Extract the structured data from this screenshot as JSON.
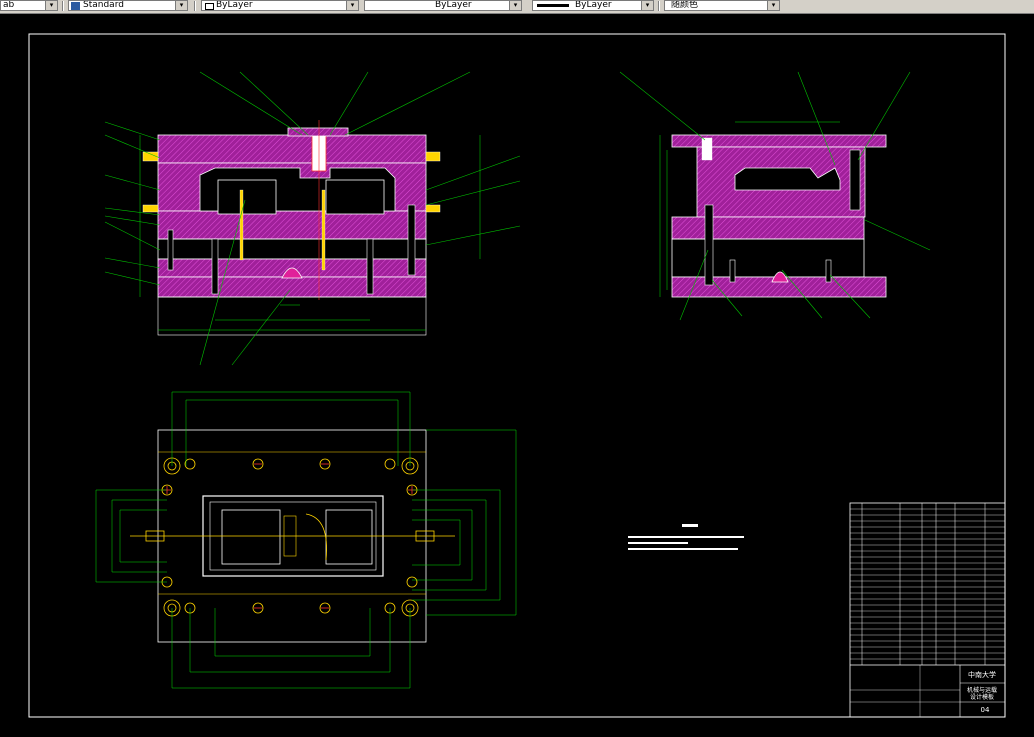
{
  "toolbar": {
    "text_style": "ab",
    "dim_style": "Standard",
    "layer": "ByLayer",
    "linetype": "ByLayer",
    "lineweight": "ByLayer",
    "plot_style": "随颜色"
  },
  "title_block": {
    "school": "中南大学",
    "drawing_title_line1": "机械与运载",
    "drawing_title_line2": "设计模板",
    "sheet_no": "04"
  },
  "colors": {
    "frame": "#ffffff",
    "mold_fill": "#a0209a",
    "hatch": "#e050d8",
    "leader": "#00c000",
    "dimension": "#00e000",
    "center_line": "#ff3030",
    "accent_yellow": "#ffd400"
  }
}
